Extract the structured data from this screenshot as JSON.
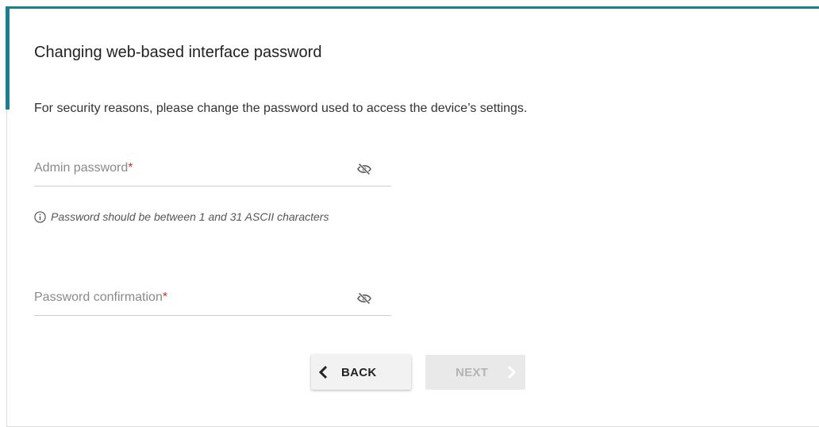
{
  "page": {
    "title": "Changing web-based interface password",
    "description": "For security reasons, please change the password used to access the device’s settings."
  },
  "form": {
    "admin_password": {
      "label": "Admin password",
      "required_mark": "*",
      "value": "",
      "visibility_icon": "eye-off-icon"
    },
    "hint": {
      "icon": "info-circle-icon",
      "text": "Password should be between 1 and 31 ASCII characters"
    },
    "password_confirmation": {
      "label": "Password confirmation",
      "required_mark": "*",
      "value": "",
      "visibility_icon": "eye-off-icon"
    }
  },
  "buttons": {
    "back": {
      "label": "BACK",
      "icon": "chevron-left-icon"
    },
    "next": {
      "label": "NEXT",
      "icon": "chevron-right-icon",
      "disabled": true
    }
  },
  "colors": {
    "accent": "#1a7f8e",
    "required": "#c0392b",
    "disabled_text": "#b4b4b4"
  }
}
